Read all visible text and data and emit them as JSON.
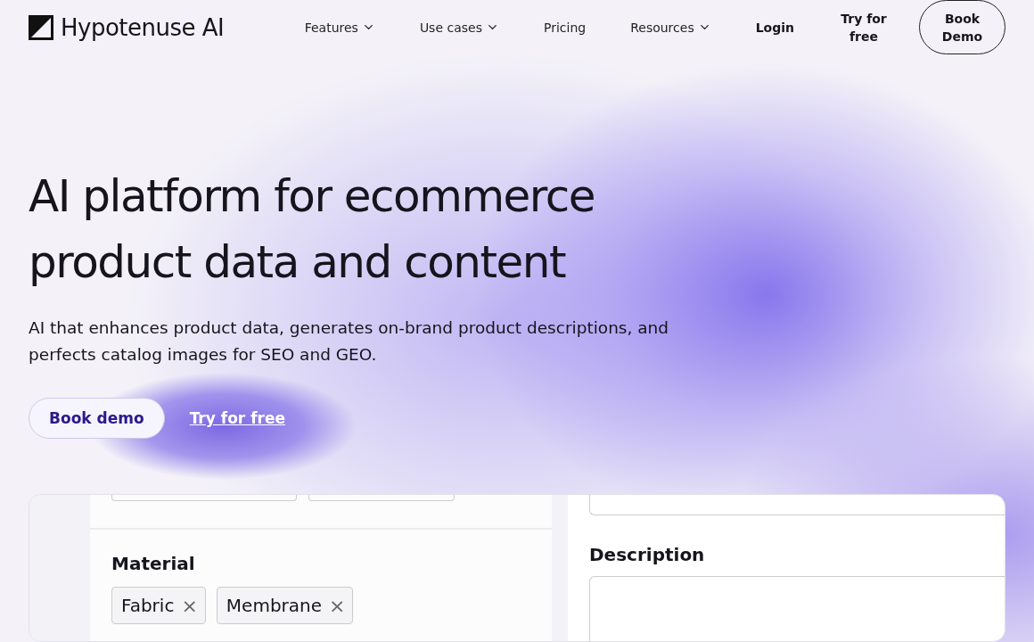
{
  "nav": {
    "logo": "Hypotenuse AI",
    "links": [
      {
        "label": "Features",
        "dropdown": true
      },
      {
        "label": "Use cases",
        "dropdown": true
      },
      {
        "label": "Pricing",
        "dropdown": false
      },
      {
        "label": "Resources",
        "dropdown": true
      }
    ],
    "login": "Login",
    "try": "Try for free",
    "book": "Book Demo"
  },
  "hero": {
    "title": "AI platform for ecommerce product data and content",
    "subtitle": "AI that enhances product data, generates on-brand product descriptions, and perfects catalog images for SEO and GEO.",
    "primary": "Book demo",
    "secondary": "Try for free"
  },
  "preview": {
    "material_label": "Material",
    "tags": [
      {
        "label": "Fabric",
        "remove": "×"
      },
      {
        "label": "Membrane",
        "remove": "×"
      }
    ],
    "description_label": "Description"
  }
}
